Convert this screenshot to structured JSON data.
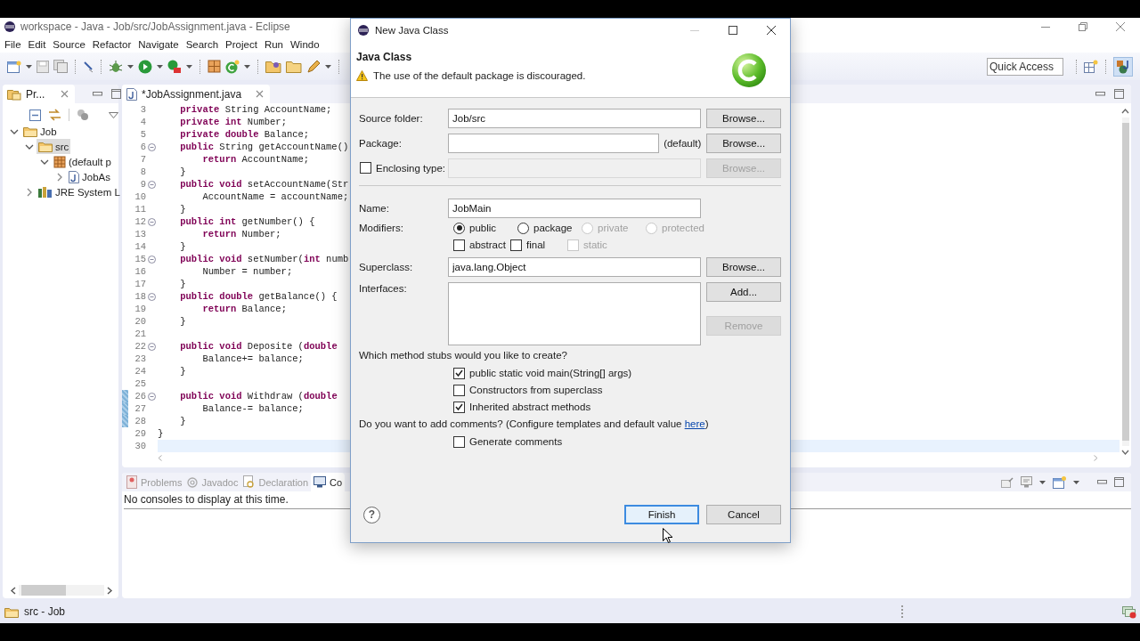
{
  "window": {
    "title": "workspace - Java - Job/src/JobAssignment.java - Eclipse"
  },
  "menu": [
    "File",
    "Edit",
    "Source",
    "Refactor",
    "Navigate",
    "Search",
    "Project",
    "Run",
    "Windo"
  ],
  "quick_access": {
    "placeholder": "Quick Access"
  },
  "explorer": {
    "tab": "Pr...",
    "tree": [
      {
        "label": "Job",
        "kind": "project",
        "expanded": true,
        "selected": false,
        "children": [
          {
            "label": "src",
            "kind": "source",
            "expanded": true,
            "selected": true,
            "children": [
              {
                "label": "(default p",
                "kind": "package",
                "expanded": true,
                "selected": false,
                "children": [
                  {
                    "label": "JobAs",
                    "kind": "java",
                    "expanded": false,
                    "selected": false
                  }
                ]
              }
            ]
          },
          {
            "label": "JRE System L",
            "kind": "library",
            "expanded": false,
            "selected": false
          }
        ]
      }
    ]
  },
  "editor": {
    "tab": "*JobAssignment.java",
    "lines": [
      {
        "number": "3",
        "code": "    **private** String AccountName;",
        "fold": false,
        "changed": false,
        "current": false
      },
      {
        "number": "4",
        "code": "    **private** **int** Number;",
        "fold": false,
        "changed": false,
        "current": false
      },
      {
        "number": "5",
        "code": "    **private** **double** Balance;",
        "fold": false,
        "changed": false,
        "current": false
      },
      {
        "number": "6",
        "code": "    **public** String getAccountName()",
        "fold": true,
        "changed": false,
        "current": false
      },
      {
        "number": "7",
        "code": "        **return** AccountName;",
        "fold": false,
        "changed": false,
        "current": false
      },
      {
        "number": "8",
        "code": "    }",
        "fold": false,
        "changed": false,
        "current": false
      },
      {
        "number": "9",
        "code": "    **public** **void** setAccountName(Str",
        "fold": true,
        "changed": false,
        "current": false
      },
      {
        "number": "10",
        "code": "        AccountName = accountName;",
        "fold": false,
        "changed": false,
        "current": false
      },
      {
        "number": "11",
        "code": "    }",
        "fold": false,
        "changed": false,
        "current": false
      },
      {
        "number": "12",
        "code": "    **public** **int** getNumber() {",
        "fold": true,
        "changed": false,
        "current": false
      },
      {
        "number": "13",
        "code": "        **return** Number;",
        "fold": false,
        "changed": false,
        "current": false
      },
      {
        "number": "14",
        "code": "    }",
        "fold": false,
        "changed": false,
        "current": false
      },
      {
        "number": "15",
        "code": "    **public** **void** setNumber(**int** numb",
        "fold": true,
        "changed": false,
        "current": false
      },
      {
        "number": "16",
        "code": "        Number = number;",
        "fold": false,
        "changed": false,
        "current": false
      },
      {
        "number": "17",
        "code": "    }",
        "fold": false,
        "changed": false,
        "current": false
      },
      {
        "number": "18",
        "code": "    **public** **double** getBalance() {",
        "fold": true,
        "changed": false,
        "current": false
      },
      {
        "number": "19",
        "code": "        **return** Balance;",
        "fold": false,
        "changed": false,
        "current": false
      },
      {
        "number": "20",
        "code": "    }",
        "fold": false,
        "changed": false,
        "current": false
      },
      {
        "number": "21",
        "fold": false,
        "changed": false,
        "current": false
      },
      {
        "number": "22",
        "code": "    **public** **void** Deposite (**double**",
        "fold": true,
        "changed": false,
        "current": false
      },
      {
        "number": "23",
        "code": "        Balance+= balance;",
        "fold": false,
        "changed": false,
        "current": false
      },
      {
        "number": "24",
        "code": "    }",
        "fold": false,
        "changed": false,
        "current": false
      },
      {
        "number": "25",
        "fold": false,
        "changed": false,
        "current": false
      },
      {
        "number": "26",
        "code": "    **public** **void** Withdraw (**double**",
        "fold": true,
        "changed": true,
        "current": false
      },
      {
        "number": "27",
        "code": "        Balance-= balance;",
        "fold": false,
        "changed": true,
        "current": false
      },
      {
        "number": "28",
        "code": "    }",
        "fold": false,
        "changed": true,
        "current": false
      },
      {
        "number": "29",
        "code": "}",
        "fold": false,
        "changed": false,
        "current": false
      },
      {
        "number": "30",
        "fold": false,
        "changed": false,
        "current": true
      }
    ]
  },
  "console": {
    "tabs": [
      {
        "label": "Problems",
        "kind": "problems",
        "selected": false
      },
      {
        "label": "Javadoc",
        "kind": "javadoc",
        "selected": false
      },
      {
        "label": "Declaration",
        "kind": "declaration",
        "selected": false
      },
      {
        "label": "Co",
        "kind": "console",
        "selected": true
      }
    ],
    "message": "No consoles to display at this time."
  },
  "status_bar": {
    "text": "src - Job"
  },
  "dialog": {
    "title": "New Java Class",
    "heading": "Java Class",
    "warning": "The use of the default package is discouraged.",
    "source_folder": {
      "label": "Source folder:",
      "value": "Job/src",
      "button": {
        "label": "Browse...",
        "disabled": false
      }
    },
    "package": {
      "label": "Package:",
      "suffix": "(default)",
      "button": {
        "label": "Browse...",
        "disabled": false
      }
    },
    "enclosing_type": {
      "label": "Enclosing type:",
      "checked": false,
      "button": {
        "label": "Browse...",
        "disabled": true
      }
    },
    "name": {
      "label": "Name:",
      "value": "JobMain"
    },
    "modifiers": {
      "label": "Modifiers:",
      "access": [
        {
          "label": "public",
          "selected": true,
          "disabled": false
        },
        {
          "label": "package",
          "selected": false,
          "disabled": false
        },
        {
          "label": "private",
          "selected": false,
          "disabled": true
        },
        {
          "label": "protected",
          "selected": false,
          "disabled": true
        }
      ],
      "flags": [
        {
          "label": "abstract",
          "checked": false,
          "disabled": false
        },
        {
          "label": "final",
          "checked": false,
          "disabled": false
        },
        {
          "label": "static",
          "checked": false,
          "disabled": true
        }
      ]
    },
    "superclass": {
      "label": "Superclass:",
      "value": "java.lang.Object",
      "button": {
        "label": "Browse...",
        "disabled": false
      }
    },
    "interfaces": {
      "label": "Interfaces:",
      "buttons": [
        {
          "label": "Add...",
          "disabled": false
        },
        {
          "label": "Remove",
          "disabled": true
        }
      ]
    },
    "stubs": {
      "question": "Which method stubs would you like to create?",
      "options": [
        {
          "label": "public static void main(String[] args)",
          "checked": true
        },
        {
          "label": "Constructors from superclass",
          "checked": false
        },
        {
          "label": "Inherited abstract methods",
          "checked": true
        }
      ]
    },
    "comments": {
      "question": "Do you want to add comments? (Configure templates and default value ",
      "link": "here",
      "after": ")",
      "options": [
        {
          "label": "Generate comments",
          "checked": false
        }
      ]
    },
    "help": "?",
    "buttons": [
      {
        "label": "Finish",
        "default": true
      },
      {
        "label": "Cancel",
        "default": false
      }
    ]
  }
}
